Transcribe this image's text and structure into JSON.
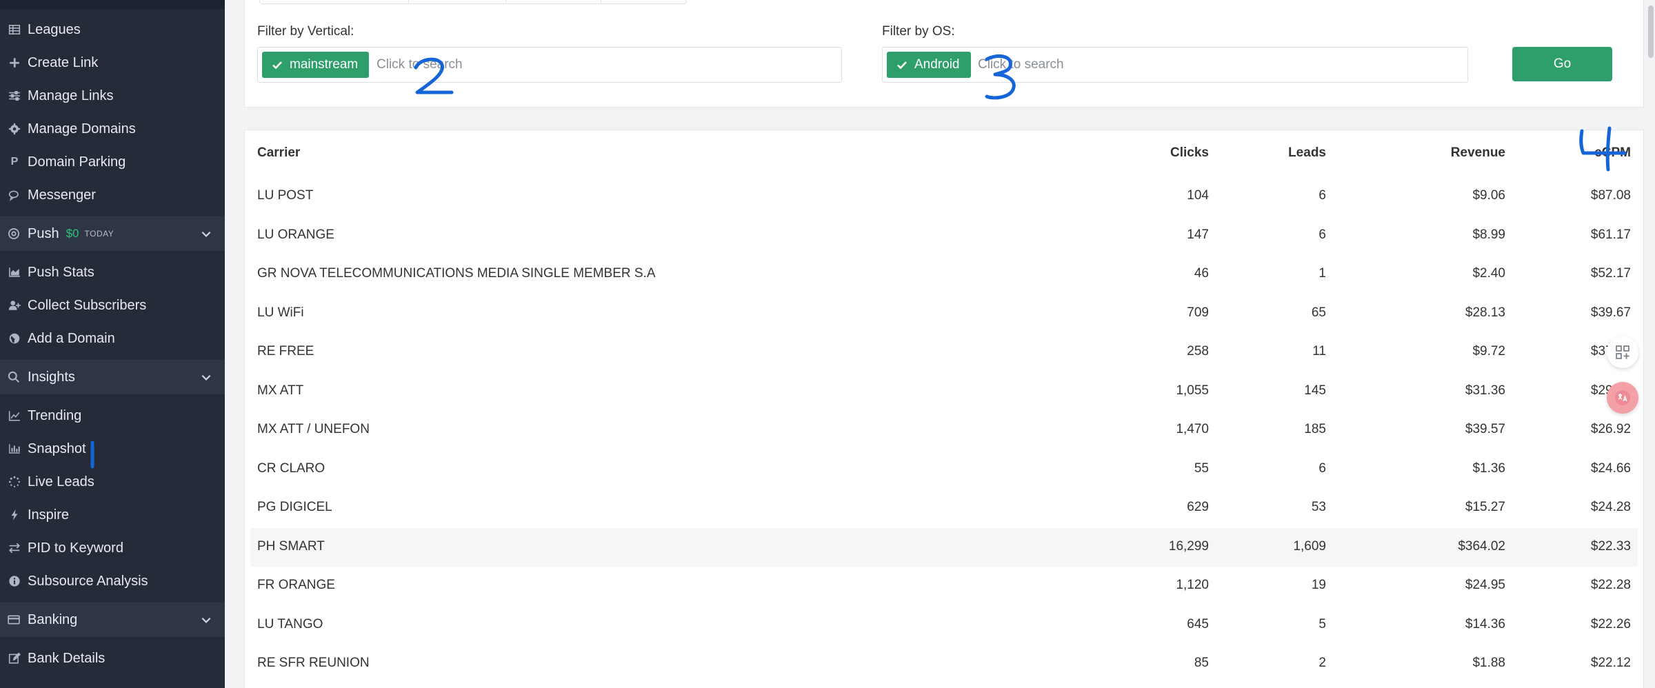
{
  "sidebar": {
    "items": [
      {
        "label": "Leagues",
        "icon": "table-icon"
      },
      {
        "label": "Create Link",
        "icon": "plus-icon"
      },
      {
        "label": "Manage Links",
        "icon": "sliders-icon"
      },
      {
        "label": "Manage Domains",
        "icon": "gear-icon"
      },
      {
        "label": "Domain Parking",
        "icon": "parking-icon"
      },
      {
        "label": "Messenger",
        "icon": "chat-icon"
      }
    ],
    "push": {
      "label": "Push",
      "amount": "$0",
      "today": "TODAY"
    },
    "push_items": [
      {
        "label": "Push Stats",
        "icon": "area-chart-icon"
      },
      {
        "label": "Collect Subscribers",
        "icon": "user-plus-icon"
      },
      {
        "label": "Add a Domain",
        "icon": "globe-icon"
      }
    ],
    "insights": {
      "label": "Insights"
    },
    "insights_items": [
      {
        "label": "Trending",
        "icon": "line-chart-icon"
      },
      {
        "label": "Snapshot",
        "icon": "bar-chart-icon"
      },
      {
        "label": "Live Leads",
        "icon": "spinner-icon"
      },
      {
        "label": "Inspire",
        "icon": "bolt-icon"
      },
      {
        "label": "PID to Keyword",
        "icon": "exchange-icon"
      },
      {
        "label": "Subsource Analysis",
        "icon": "info-icon"
      }
    ],
    "banking": {
      "label": "Banking"
    },
    "banking_items": [
      {
        "label": "Bank Details",
        "icon": "edit-icon"
      }
    ]
  },
  "filters": {
    "vertical": {
      "label": "Filter by Vertical:",
      "chip": "mainstream",
      "placeholder": "Click to search"
    },
    "os": {
      "label": "Filter by OS:",
      "chip": "Android",
      "placeholder": "Click to search"
    },
    "go_label": "Go"
  },
  "table": {
    "headers": {
      "carrier": "Carrier",
      "clicks": "Clicks",
      "leads": "Leads",
      "revenue": "Revenue",
      "ecpm": "eCPM"
    },
    "rows": [
      {
        "carrier": "LU POST",
        "clicks": "104",
        "leads": "6",
        "revenue": "$9.06",
        "ecpm": "$87.08"
      },
      {
        "carrier": "LU ORANGE",
        "clicks": "147",
        "leads": "6",
        "revenue": "$8.99",
        "ecpm": "$61.17"
      },
      {
        "carrier": "GR NOVA TELECOMMUNICATIONS MEDIA SINGLE MEMBER S.A",
        "clicks": "46",
        "leads": "1",
        "revenue": "$2.40",
        "ecpm": "$52.17"
      },
      {
        "carrier": "LU WiFi",
        "clicks": "709",
        "leads": "65",
        "revenue": "$28.13",
        "ecpm": "$39.67"
      },
      {
        "carrier": "RE FREE",
        "clicks": "258",
        "leads": "11",
        "revenue": "$9.72",
        "ecpm": "$37.67"
      },
      {
        "carrier": "MX ATT",
        "clicks": "1,055",
        "leads": "145",
        "revenue": "$31.36",
        "ecpm": "$29.72"
      },
      {
        "carrier": "MX ATT / UNEFON",
        "clicks": "1,470",
        "leads": "185",
        "revenue": "$39.57",
        "ecpm": "$26.92"
      },
      {
        "carrier": "CR CLARO",
        "clicks": "55",
        "leads": "6",
        "revenue": "$1.36",
        "ecpm": "$24.66"
      },
      {
        "carrier": "PG DIGICEL",
        "clicks": "629",
        "leads": "53",
        "revenue": "$15.27",
        "ecpm": "$24.28"
      },
      {
        "carrier": "PH SMART",
        "clicks": "16,299",
        "leads": "1,609",
        "revenue": "$364.02",
        "ecpm": "$22.33"
      },
      {
        "carrier": "FR ORANGE",
        "clicks": "1,120",
        "leads": "19",
        "revenue": "$24.95",
        "ecpm": "$22.28"
      },
      {
        "carrier": "LU TANGO",
        "clicks": "645",
        "leads": "5",
        "revenue": "$14.36",
        "ecpm": "$22.26"
      },
      {
        "carrier": "RE SFR REUNION",
        "clicks": "85",
        "leads": "2",
        "revenue": "$1.88",
        "ecpm": "$22.12"
      }
    ]
  },
  "annotations": [
    "1",
    "2",
    "3",
    "4"
  ],
  "colors": {
    "sidebar": "#252b38",
    "section": "#2e3545",
    "accent": "#2e9f6a",
    "ink": "#1565d8"
  }
}
